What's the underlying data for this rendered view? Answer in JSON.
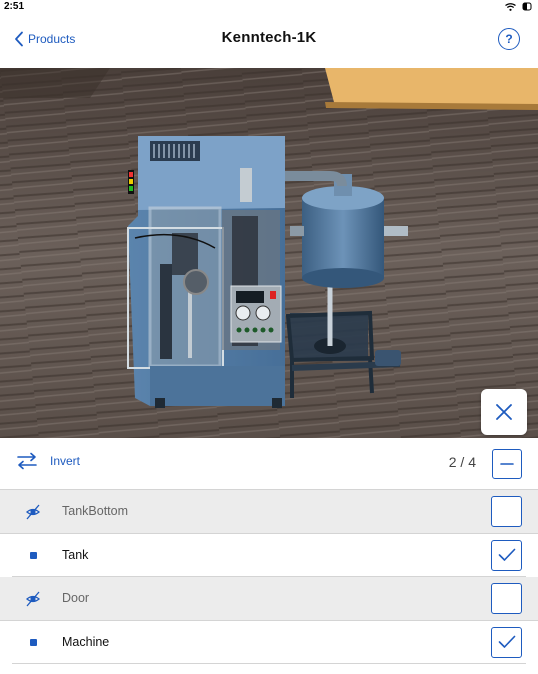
{
  "status": {
    "time": "2:51",
    "icons": [
      "wifi-icon",
      "battery-icon"
    ]
  },
  "nav": {
    "back_label": "Products",
    "title": "Kenntech-1K",
    "help_label": "?"
  },
  "toolbar": {
    "invert_label": "Invert",
    "counter": "2 / 4"
  },
  "parts": [
    {
      "label": "TankBottom",
      "visible": false
    },
    {
      "label": "Tank",
      "visible": true
    },
    {
      "label": "Door",
      "visible": false
    },
    {
      "label": "Machine",
      "visible": true
    }
  ],
  "colors": {
    "accent": "#1e5bbf",
    "hidden_row_bg": "#ececec",
    "divider": "#d4d4d4"
  }
}
